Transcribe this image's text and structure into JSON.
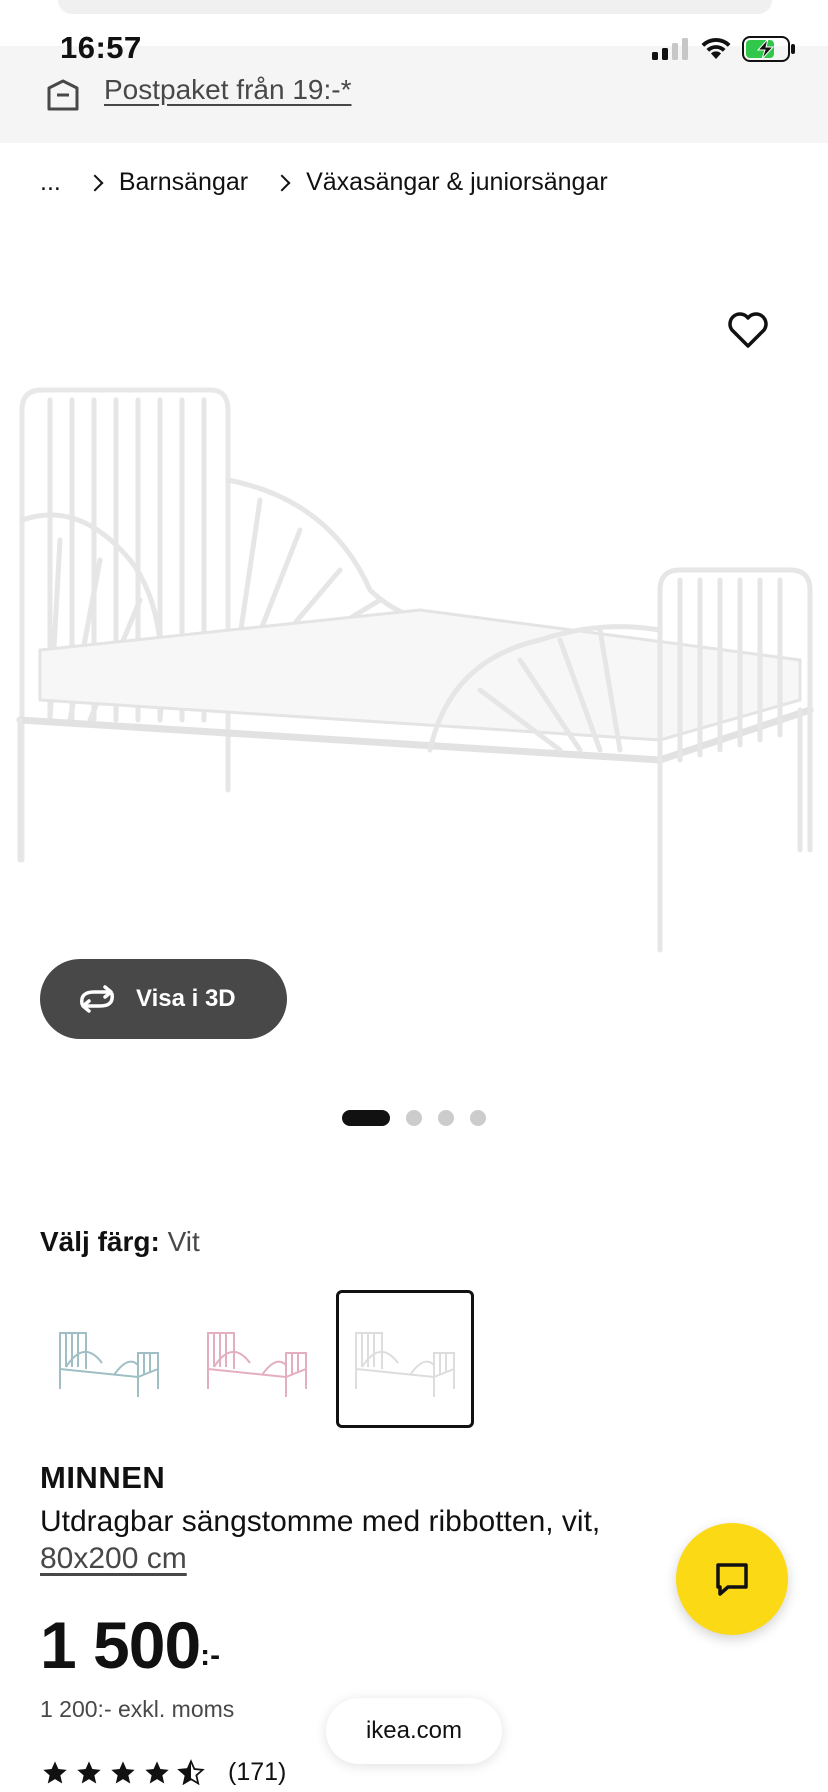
{
  "status_bar": {
    "time": "16:57",
    "signal_icon": "cellular-signal-icon",
    "wifi_icon": "wifi-icon",
    "battery_icon": "battery-charging-icon",
    "battery_color": "#30c74a"
  },
  "delivery_banner": {
    "icon": "delivery-box-icon",
    "text": "Postpaket från 19:-*"
  },
  "breadcrumb": {
    "items": [
      "...",
      "Barnsängar",
      "Växasängar & juniorsängar"
    ]
  },
  "product_image": {
    "favorite_icon": "heart-outline-icon"
  },
  "view_3d": {
    "icon": "rotate-3d-icon",
    "label": "Visa i 3D"
  },
  "carousel": {
    "total": 4,
    "active_index": 0
  },
  "color_selector": {
    "label": "Välj färg:",
    "selected_value": "Vit",
    "options": [
      {
        "color": "#a8c8cc",
        "selected": false
      },
      {
        "color": "#e8b8c8",
        "selected": false
      },
      {
        "color": "#eeeeee",
        "selected": true
      }
    ]
  },
  "product": {
    "name": "MINNEN",
    "description": "Utdragbar sängstomme med ribbotten, vit,",
    "size": "80x200 cm",
    "price_main": "1 500",
    "price_suffix": ":-",
    "price_excl": "1 200:- exkl. moms",
    "rating_value": 4.5,
    "rating_count": "(171)"
  },
  "chat": {
    "icon": "chat-bubble-icon",
    "color": "#fbd914"
  },
  "browser": {
    "url": "ikea.com"
  }
}
